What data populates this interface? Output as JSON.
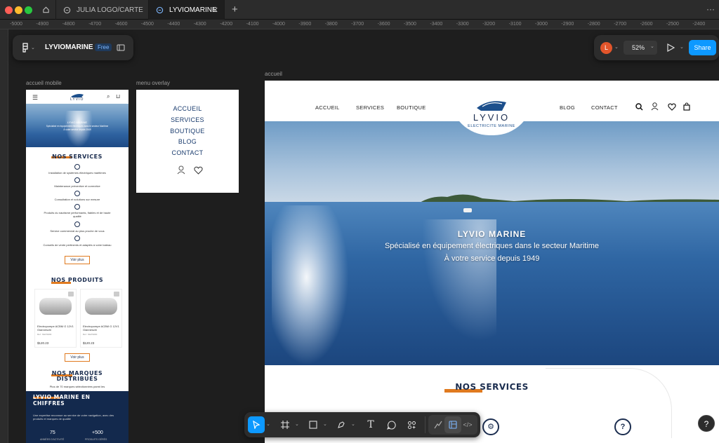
{
  "tabs": [
    {
      "label": "JULIA LOGO/CARTE"
    },
    {
      "label": "LYVIOMARINE"
    }
  ],
  "ruler_ticks": [
    "-5000",
    "-4900",
    "-4800",
    "-4700",
    "-4600",
    "-4500",
    "-4400",
    "-4300",
    "-4200",
    "-4100",
    "-4000",
    "-3900",
    "-3800",
    "-3700",
    "-3600",
    "-3500",
    "-3400",
    "-3300",
    "-3200",
    "-3100",
    "-3000",
    "-2900",
    "-2800",
    "-2700",
    "-2600",
    "-2500",
    "-2400"
  ],
  "file": {
    "name": "LYVIOMARINE",
    "plan": "Free"
  },
  "toolbar_right": {
    "avatar_initial": "L",
    "zoom": "52%",
    "share": "Share"
  },
  "frames": {
    "mobile": "accueil mobile",
    "overlay": "menu overlay",
    "main": "accueil"
  },
  "site": {
    "nav_left": [
      "ACCUEIL",
      "SERVICES",
      "BOUTIQUE"
    ],
    "nav_right": [
      "BLOG",
      "CONTACT"
    ],
    "logo_name": "LYVIO",
    "logo_tagline": "ELECTRICITE MARINE",
    "hero_title": "LYVIO MARINE",
    "hero_line1": "Spécialisé en équipement électriques dans le secteur Maritime",
    "hero_line2": "À votre service depuis 1949",
    "services_heading": "NOS SERVICES"
  },
  "overlay_menu": [
    "ACCUEIL",
    "SERVICES",
    "BOUTIQUE",
    "BLOG",
    "CONTACT"
  ],
  "mobile": {
    "services_heading": "NOS SERVICES",
    "services": [
      "Installation de systèmes électriques maritimes",
      "Maintenance préventive et corrective",
      "Consultation et solutions sur mesure",
      "Produits du nautisme performants, fiables et de haute qualité",
      "Service commercial au plus proche de vous",
      "Conseils de vente pertinents et adaptés à votre bateau"
    ],
    "cta": "Voir plus",
    "products_heading": "NOS PRODUITS",
    "products": [
      {
        "name": "Electropompe ACBM G 12V1 Gianneschi",
        "ref": "Ref : NEXS000",
        "price": "$120.23"
      },
      {
        "name": "Electropompe ACBM G 12V1 Gianneschi",
        "ref": "Ref : NEXS000",
        "price": "$120.23"
      }
    ],
    "cta2": "Voir plus",
    "brands_heading_1": "NOS MARQUES",
    "brands_heading_2": "DISTRIBUÉS",
    "brands_sub": "Plus de 70 marques sélectionnées parmi les",
    "figures_heading_1": "LYVIO MARINE EN",
    "figures_heading_2": "CHIFFRES",
    "figures_text": "Une expertise reconnue au service de votre navigation, avec des produits et marques de qualité",
    "stats": [
      {
        "value": "75",
        "label": "ANNÉES D'ACTIVITÉ"
      },
      {
        "value": "+500",
        "label": "PRODUITS GÉRÉS"
      }
    ]
  },
  "help": "?"
}
